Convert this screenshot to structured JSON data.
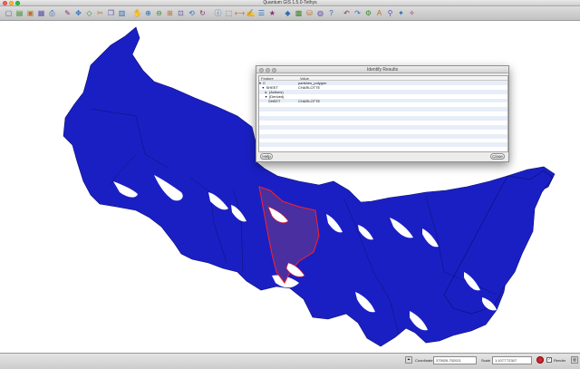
{
  "window": {
    "title": "Quantum GIS 1.5.0-Tethys"
  },
  "toolbar": {
    "icons": [
      "new-project-icon",
      "open-project-icon",
      "save-project-icon",
      "save-as-icon",
      "print-icon",
      "digitize-icon",
      "move-feature-icon",
      "node-tool-icon",
      "cut-icon",
      "copy-icon",
      "paste-icon",
      "pan-icon",
      "zoom-in-icon",
      "zoom-out-icon",
      "zoom-full-icon",
      "zoom-layer-icon",
      "zoom-last-icon",
      "refresh-icon",
      "identify-icon",
      "select-icon",
      "measure-icon",
      "annotation-icon",
      "map-tips-icon",
      "bookmark-icon",
      "add-vector-icon",
      "add-raster-icon",
      "add-postgis-icon",
      "add-wms-icon",
      "help-icon",
      "undo-icon",
      "redo-icon",
      "plugin-icon",
      "label-icon",
      "pin-icon",
      "python-icon",
      "gps-icon"
    ]
  },
  "dialog": {
    "title": "Identify Results",
    "col_feature": "Feature",
    "col_value": "Value",
    "rows": [
      {
        "feature": "▾  0",
        "value": "parishes_polygon"
      },
      {
        "feature": "   ▾  SHEET",
        "value": "CHARLOTTE"
      },
      {
        "feature": "      ▸  (Actions)",
        "value": ""
      },
      {
        "feature": "      ▾  (Derived)",
        "value": ""
      },
      {
        "feature": "         SHEET",
        "value": "CHARLOTTE"
      }
    ],
    "help_label": "Help",
    "close_label": "Close"
  },
  "status": {
    "coordinate_label": "Coordinate:",
    "coordinate_value": "375926,752021",
    "scale_label": "Scale",
    "scale_value": "1:1077'72307",
    "render_label": "Render"
  },
  "colors": {
    "land": "#1a1fc4",
    "selected": "#4a2fa0",
    "selection_outline": "#ff2020"
  }
}
